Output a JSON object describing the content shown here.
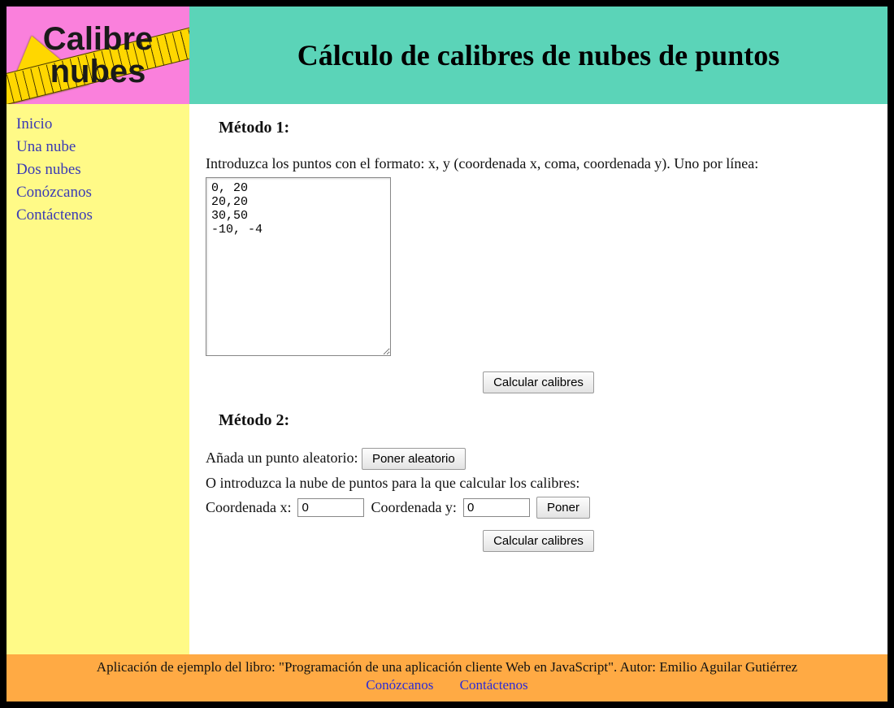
{
  "logo": {
    "line1": "Calibre",
    "line2": "nubes"
  },
  "header": {
    "title": "Cálculo de calibres de nubes de puntos"
  },
  "sidebar": {
    "items": [
      {
        "label": "Inicio"
      },
      {
        "label": "Una nube"
      },
      {
        "label": "Dos nubes"
      },
      {
        "label": "Conózcanos"
      },
      {
        "label": "Contáctenos"
      }
    ]
  },
  "main": {
    "method1": {
      "title": "Método 1:",
      "instruction": "Introduzca los puntos con el formato: x, y (coordenada x, coma, coordenada y). Uno por línea:",
      "textarea_value": "0, 20\n20,20\n30,50\n-10, -4",
      "calc_button": "Calcular calibres"
    },
    "method2": {
      "title": "Método 2:",
      "random_label": "Añada un punto aleatorio:",
      "random_button": "Poner aleatorio",
      "manual_label": "O introduzca la nube de puntos para la que calcular los calibres:",
      "coord_x_label": "Coordenada x:",
      "coord_x_value": "0",
      "coord_y_label": "Coordenada y:",
      "coord_y_value": "0",
      "put_button": "Poner",
      "calc_button": "Calcular calibres"
    }
  },
  "footer": {
    "text": "Aplicación de ejemplo del libro: \"Programación de una aplicación cliente Web en JavaScript\". Autor: Emilio Aguilar Gutiérrez",
    "link1": "Conózcanos",
    "link2": "Contáctenos"
  }
}
